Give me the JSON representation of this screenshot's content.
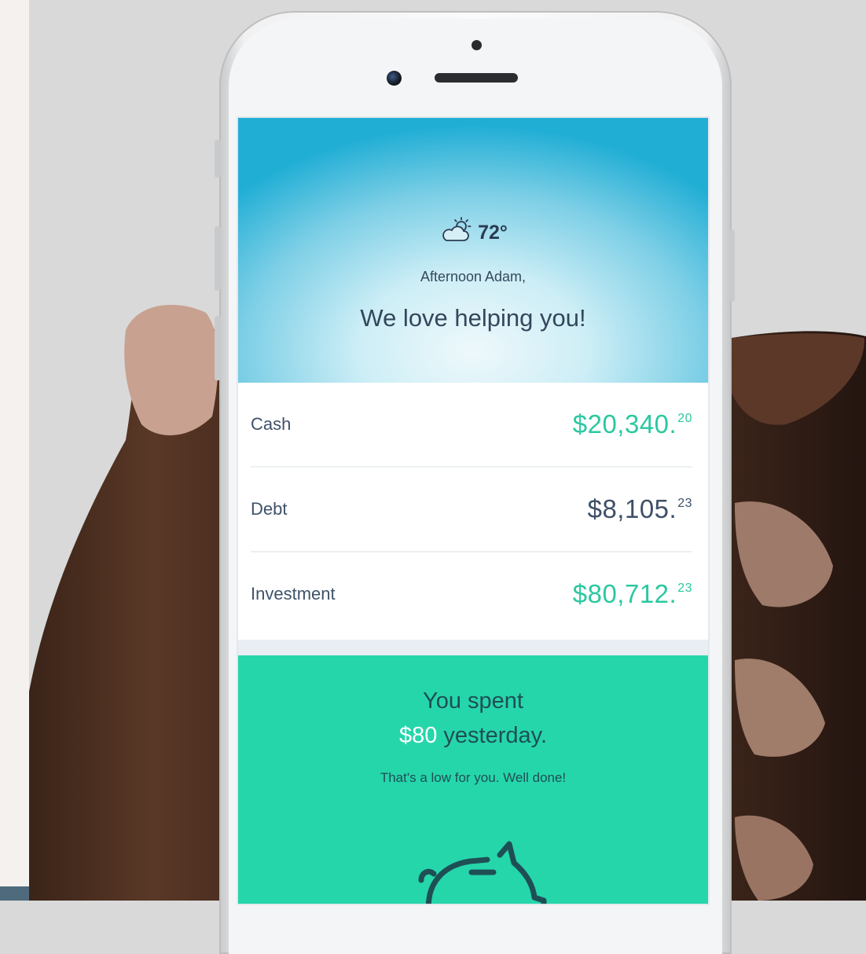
{
  "weather": {
    "icon": "partly-cloudy-sun-icon",
    "temperature": "72°"
  },
  "greeting": "Afternoon Adam,",
  "headline": "We love helping you!",
  "accounts": [
    {
      "label": "Cash",
      "amount": "$20,340.",
      "cents": "20",
      "color": "#2bc8a0"
    },
    {
      "label": "Debt",
      "amount": "$8,105.",
      "cents": "23",
      "color": "#3e5068"
    },
    {
      "label": "Investment",
      "amount": "$80,712.",
      "cents": "23",
      "color": "#2bc8a0"
    }
  ],
  "spending": {
    "line1": "You spent",
    "amount": "$80",
    "line2_suffix": " yesterday.",
    "note": "That's a low for you. Well done!",
    "icon": "piggy-bank-icon"
  },
  "colors": {
    "accent_green": "#2bc8a0",
    "spend_card": "#26d6ab",
    "hero_blue": "#21aed5",
    "text_dark": "#34475d"
  }
}
